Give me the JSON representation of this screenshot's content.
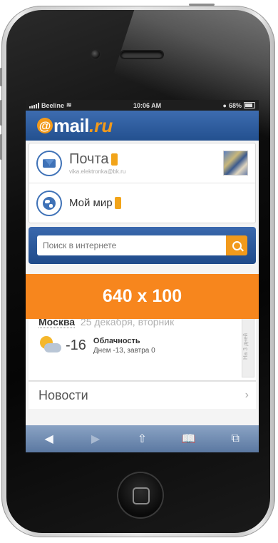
{
  "statusbar": {
    "carrier": "Beeline",
    "time": "10:06 AM",
    "battery": "68%"
  },
  "header": {
    "logo_main": "mail",
    "logo_suffix": ".ru"
  },
  "services": [
    {
      "title": "Почта",
      "subtitle": "vika.elektronka@bk.ru"
    },
    {
      "title": "Мой мир"
    }
  ],
  "search": {
    "placeholder": "Поиск в интернете"
  },
  "ad": {
    "label": "640 x 100"
  },
  "weather": {
    "city": "Москва",
    "date": "25 декабря, вторник",
    "temp": "-16",
    "condition": "Облачность",
    "details": "Днем -13, завтра 0",
    "side_label": "На 3 дней"
  },
  "news": {
    "label": "Новости",
    "arrow": "›"
  },
  "toolbar": {
    "back": "◀",
    "forward": "▶",
    "share": "⇧",
    "bookmarks": "📖",
    "tabs": "⧉"
  },
  "colors": {
    "brand_blue": "#2d5b9e",
    "brand_orange": "#f29a1b",
    "ad_orange": "#f7861d"
  }
}
